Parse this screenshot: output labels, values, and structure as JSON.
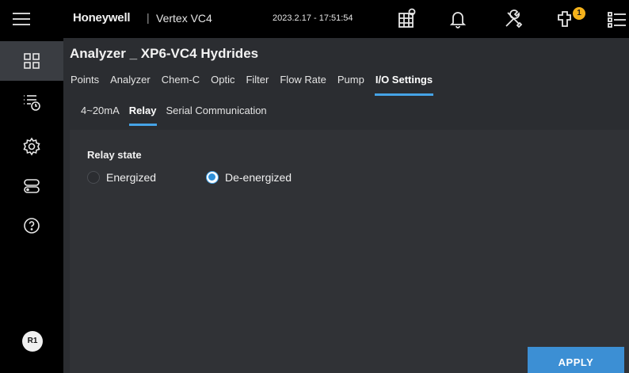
{
  "header": {
    "brand": "Honeywell",
    "separator": "|",
    "product": "Vertex VC4",
    "datetime": "2023.2.17 - 17:51:54",
    "notification_count": "1",
    "icons": [
      "menu-icon",
      "calendar-status-icon",
      "bell-icon",
      "tools-icon",
      "maintenance-icon",
      "list-settings-icon"
    ]
  },
  "sidebar": {
    "items": [
      {
        "icon": "dashboard-grid-icon",
        "active": true
      },
      {
        "icon": "event-history-icon"
      },
      {
        "icon": "gear-icon"
      },
      {
        "icon": "storage-icon"
      },
      {
        "icon": "help-icon"
      }
    ],
    "user_initials": "R1"
  },
  "page": {
    "title": "Analyzer _ XP6-VC4 Hydrides",
    "tabs": [
      "Points",
      "Analyzer",
      "Chem-C",
      "Optic",
      "Filter",
      "Flow Rate",
      "Pump",
      "I/O Settings"
    ],
    "active_tab": "I/O Settings",
    "subtabs": [
      "4~20mA",
      "Relay",
      "Serial Communication"
    ],
    "active_subtab": "Relay"
  },
  "relay": {
    "label": "Relay state",
    "options": [
      "Energized",
      "De-energized"
    ],
    "selected": "De-energized"
  },
  "actions": {
    "apply_label": "APPLY"
  },
  "colors": {
    "accent": "#45a3e6",
    "apply_button": "#3c8fd4",
    "badge": "#f5b21b",
    "panel": "#2b2d31"
  }
}
